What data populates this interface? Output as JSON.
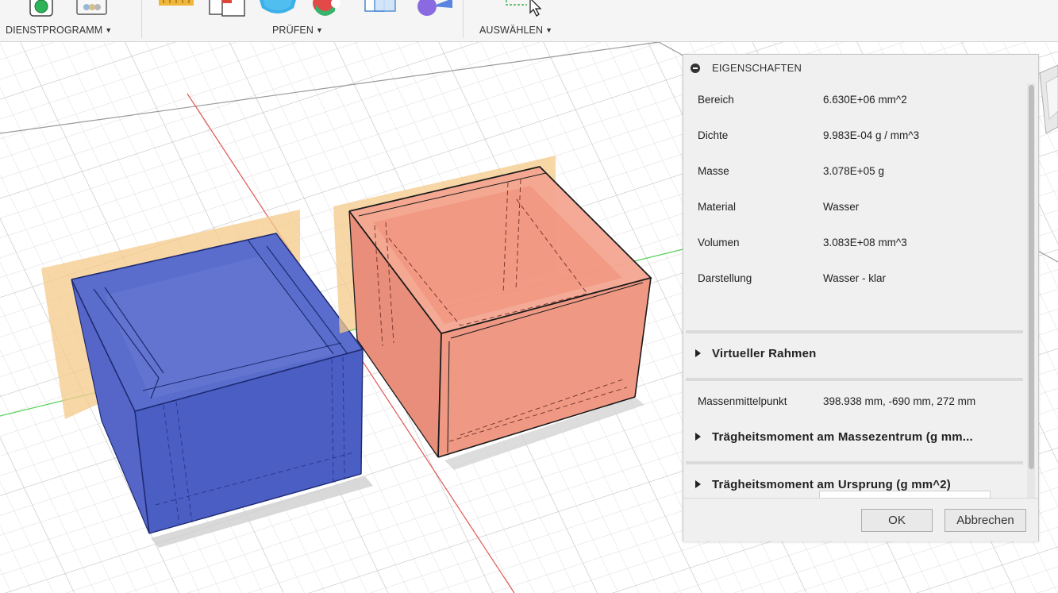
{
  "toolbar": {
    "groups": [
      {
        "label": "DIENSTPROGRAMM"
      },
      {
        "label": "PRÜFEN"
      },
      {
        "label": "AUSWÄHLEN"
      }
    ]
  },
  "dialog": {
    "title": "EIGENSCHAFTEN",
    "properties": [
      {
        "label": "Bereich",
        "value": "6.630E+06 mm^2"
      },
      {
        "label": "Dichte",
        "value": "9.983E-04 g / mm^3"
      },
      {
        "label": "Masse",
        "value": "3.078E+05 g"
      },
      {
        "label": "Material",
        "value": "Wasser"
      },
      {
        "label": "Volumen",
        "value": "3.083E+08 mm^3"
      },
      {
        "label": "Darstellung",
        "value": "Wasser - klar"
      }
    ],
    "section_virtual_frame": "Virtueller Rahmen",
    "center_of_mass": {
      "label": "Massenmittelpunkt",
      "value": "398.938 mm, -690 mm, 272 mm"
    },
    "section_inertia_center": "Trägheitsmoment am Massezentrum   (g mm...",
    "section_inertia_origin": "Trägheitsmoment am Ursprung   (g mm^2)",
    "ok_label": "OK",
    "cancel_label": "Abbrechen"
  },
  "colors": {
    "blue_body": "#4a5ec4",
    "salmon_body": "#f2957f",
    "plane_orange": "#f5c98a",
    "x_axis": "#e05555",
    "y_axis": "#5fd35f"
  },
  "icons": [
    "record-icon",
    "gallery-icon",
    "measure-icon",
    "interference-icon",
    "cylinder-icon",
    "section-icon",
    "select-box-icon",
    "sphere-icon",
    "cursor-icon"
  ]
}
